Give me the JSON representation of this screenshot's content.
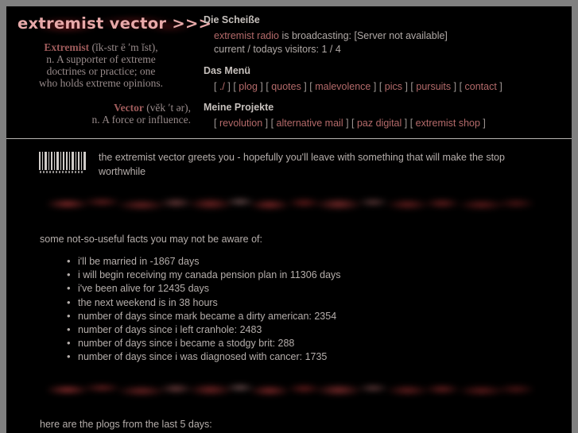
{
  "site": {
    "logo": "extremist vector >>>"
  },
  "definitions": {
    "extremist": {
      "word": "Extremist",
      "phonetic": "(ĭk-str ē ʹm ĭst),",
      "line2": "n. A supporter of extreme",
      "line3": "doctrines or practice; one",
      "line4": "who holds extreme opinions."
    },
    "vector": {
      "word": "Vector",
      "phonetic": "(vĕk ʹt ər),",
      "line2": "n. A force or influence."
    }
  },
  "status": {
    "heading": "Die Scheiße",
    "radio_link": "extremist radio",
    "radio_rest": " is broadcasting: [Server not available]",
    "visitors": "current / todays visitors: 1 / 4"
  },
  "menu": {
    "heading": "Das Menü",
    "items": [
      "./",
      "plog",
      "quotes",
      "malevolence",
      "pics",
      "pursuits",
      "contact"
    ]
  },
  "projects": {
    "heading": "Meine Projekte",
    "items": [
      "revolution",
      "alternative mail",
      "paz digital",
      "extremist shop"
    ]
  },
  "greeting": {
    "barcode_icon": "barcode-icon",
    "text": "the extremist vector greets you - hopefully you'll leave with something that will make the stop worthwhile"
  },
  "facts": {
    "intro": "some not-so-useful facts you may not be aware of:",
    "items": [
      "i'll be married in -1867 days",
      "i will begin receiving my canada pension plan in 11306 days",
      "i've been alive for 12435 days",
      "the next weekend is in 38 hours",
      "number of days since mark became a dirty american: 2354",
      "number of days since i left cranhole: 2483",
      "number of days since i became a stodgy brit: 288",
      "number of days since i was diagnosed with cancer: 1735"
    ]
  },
  "plogs": {
    "heading": "here are the plogs from the last 5 days:"
  },
  "colors": {
    "background": "#000000",
    "chrome": "#808080",
    "link": "#b46a6a",
    "text": "#b5aeab",
    "heading": "#c6c0bc",
    "logo": "#e7a9a9",
    "accent_red": "#9f5b5b"
  }
}
